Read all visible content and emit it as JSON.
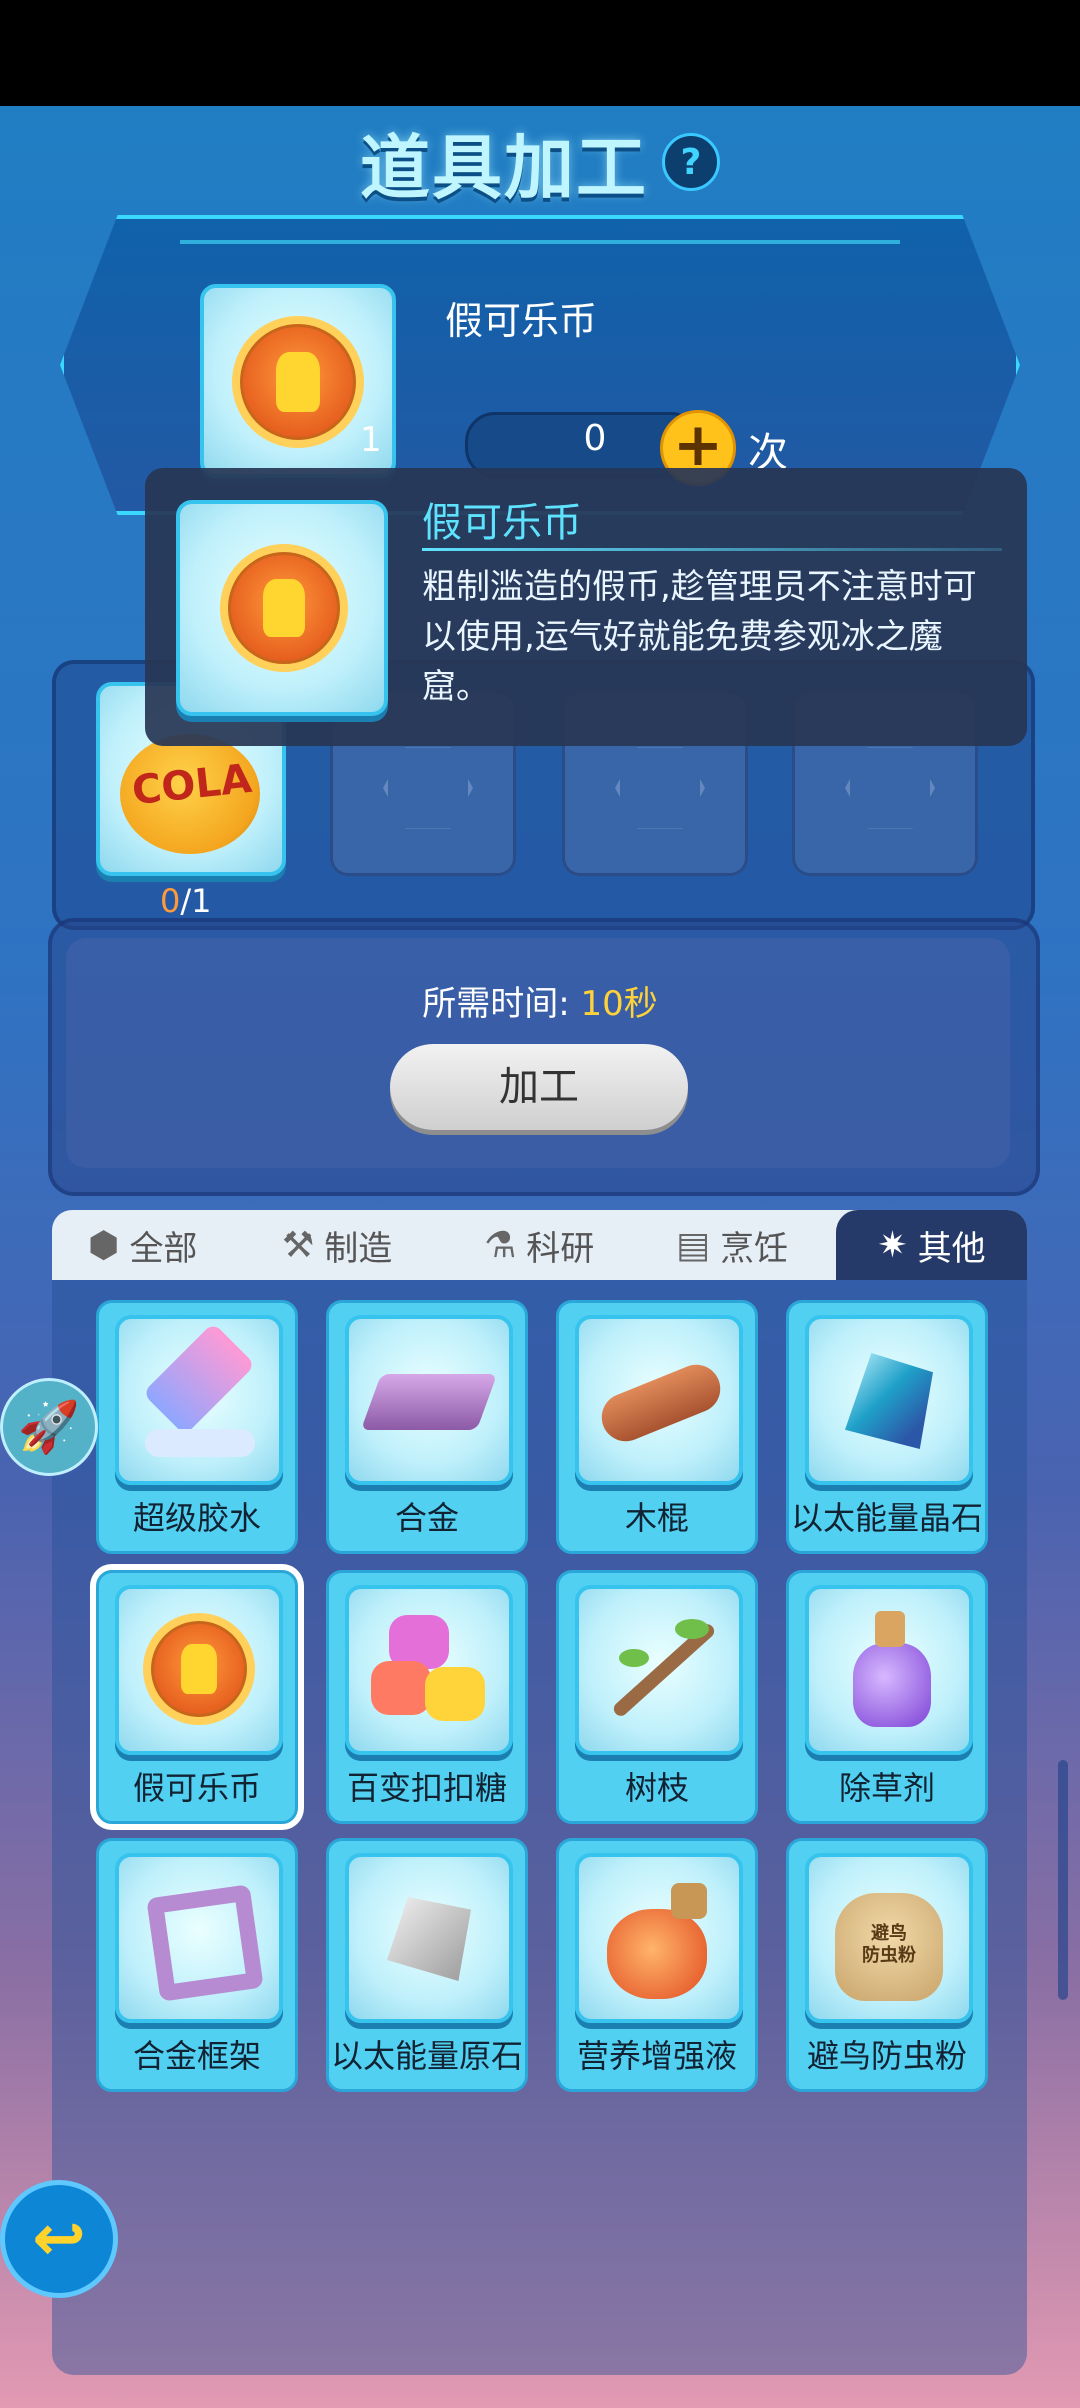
{
  "title": "道具加工",
  "selected_item": {
    "name": "假可乐币",
    "owned": "1",
    "amount": "0",
    "times_label": "次"
  },
  "tooltip": {
    "name": "假可乐币",
    "description": "粗制滥造的假币,趁管理员不注意时可以使用,运气好就能免费参观冰之魔窟。"
  },
  "materials": [
    {
      "name": "cola-cap-icon",
      "have": "0",
      "need": "1"
    }
  ],
  "process": {
    "time_label": "所需时间:",
    "time_value": "10秒",
    "button": "加工"
  },
  "tabs": [
    {
      "label": "全部",
      "icon": "hexagon-icon"
    },
    {
      "label": "制造",
      "icon": "tools-icon"
    },
    {
      "label": "科研",
      "icon": "flask-icon"
    },
    {
      "label": "烹饪",
      "icon": "stove-icon"
    },
    {
      "label": "其他",
      "icon": "gear-icon",
      "active": true
    }
  ],
  "items": [
    {
      "label": "超级胶水",
      "icon": "glue-icon"
    },
    {
      "label": "合金",
      "icon": "alloy-icon"
    },
    {
      "label": "木棍",
      "icon": "log-icon"
    },
    {
      "label": "以太能量晶石",
      "icon": "crystal-icon"
    },
    {
      "label": "假可乐币",
      "icon": "coin-icon",
      "selected": true
    },
    {
      "label": "百变扣扣糖",
      "icon": "candy-icon"
    },
    {
      "label": "树枝",
      "icon": "branch-icon"
    },
    {
      "label": "除草剂",
      "icon": "potion-icon"
    },
    {
      "label": "合金框架",
      "icon": "frame-icon"
    },
    {
      "label": "以太能量原石",
      "icon": "ore-icon"
    },
    {
      "label": "营养增强液",
      "icon": "jar-icon"
    },
    {
      "label": "避鸟防虫粉",
      "icon": "sack-icon",
      "sack_text": "避鸟\n防虫粉"
    }
  ],
  "colors": {
    "accent_cyan": "#5ee3ff",
    "time_value": "#ffd23a",
    "material_have": "#ff9a3c"
  }
}
